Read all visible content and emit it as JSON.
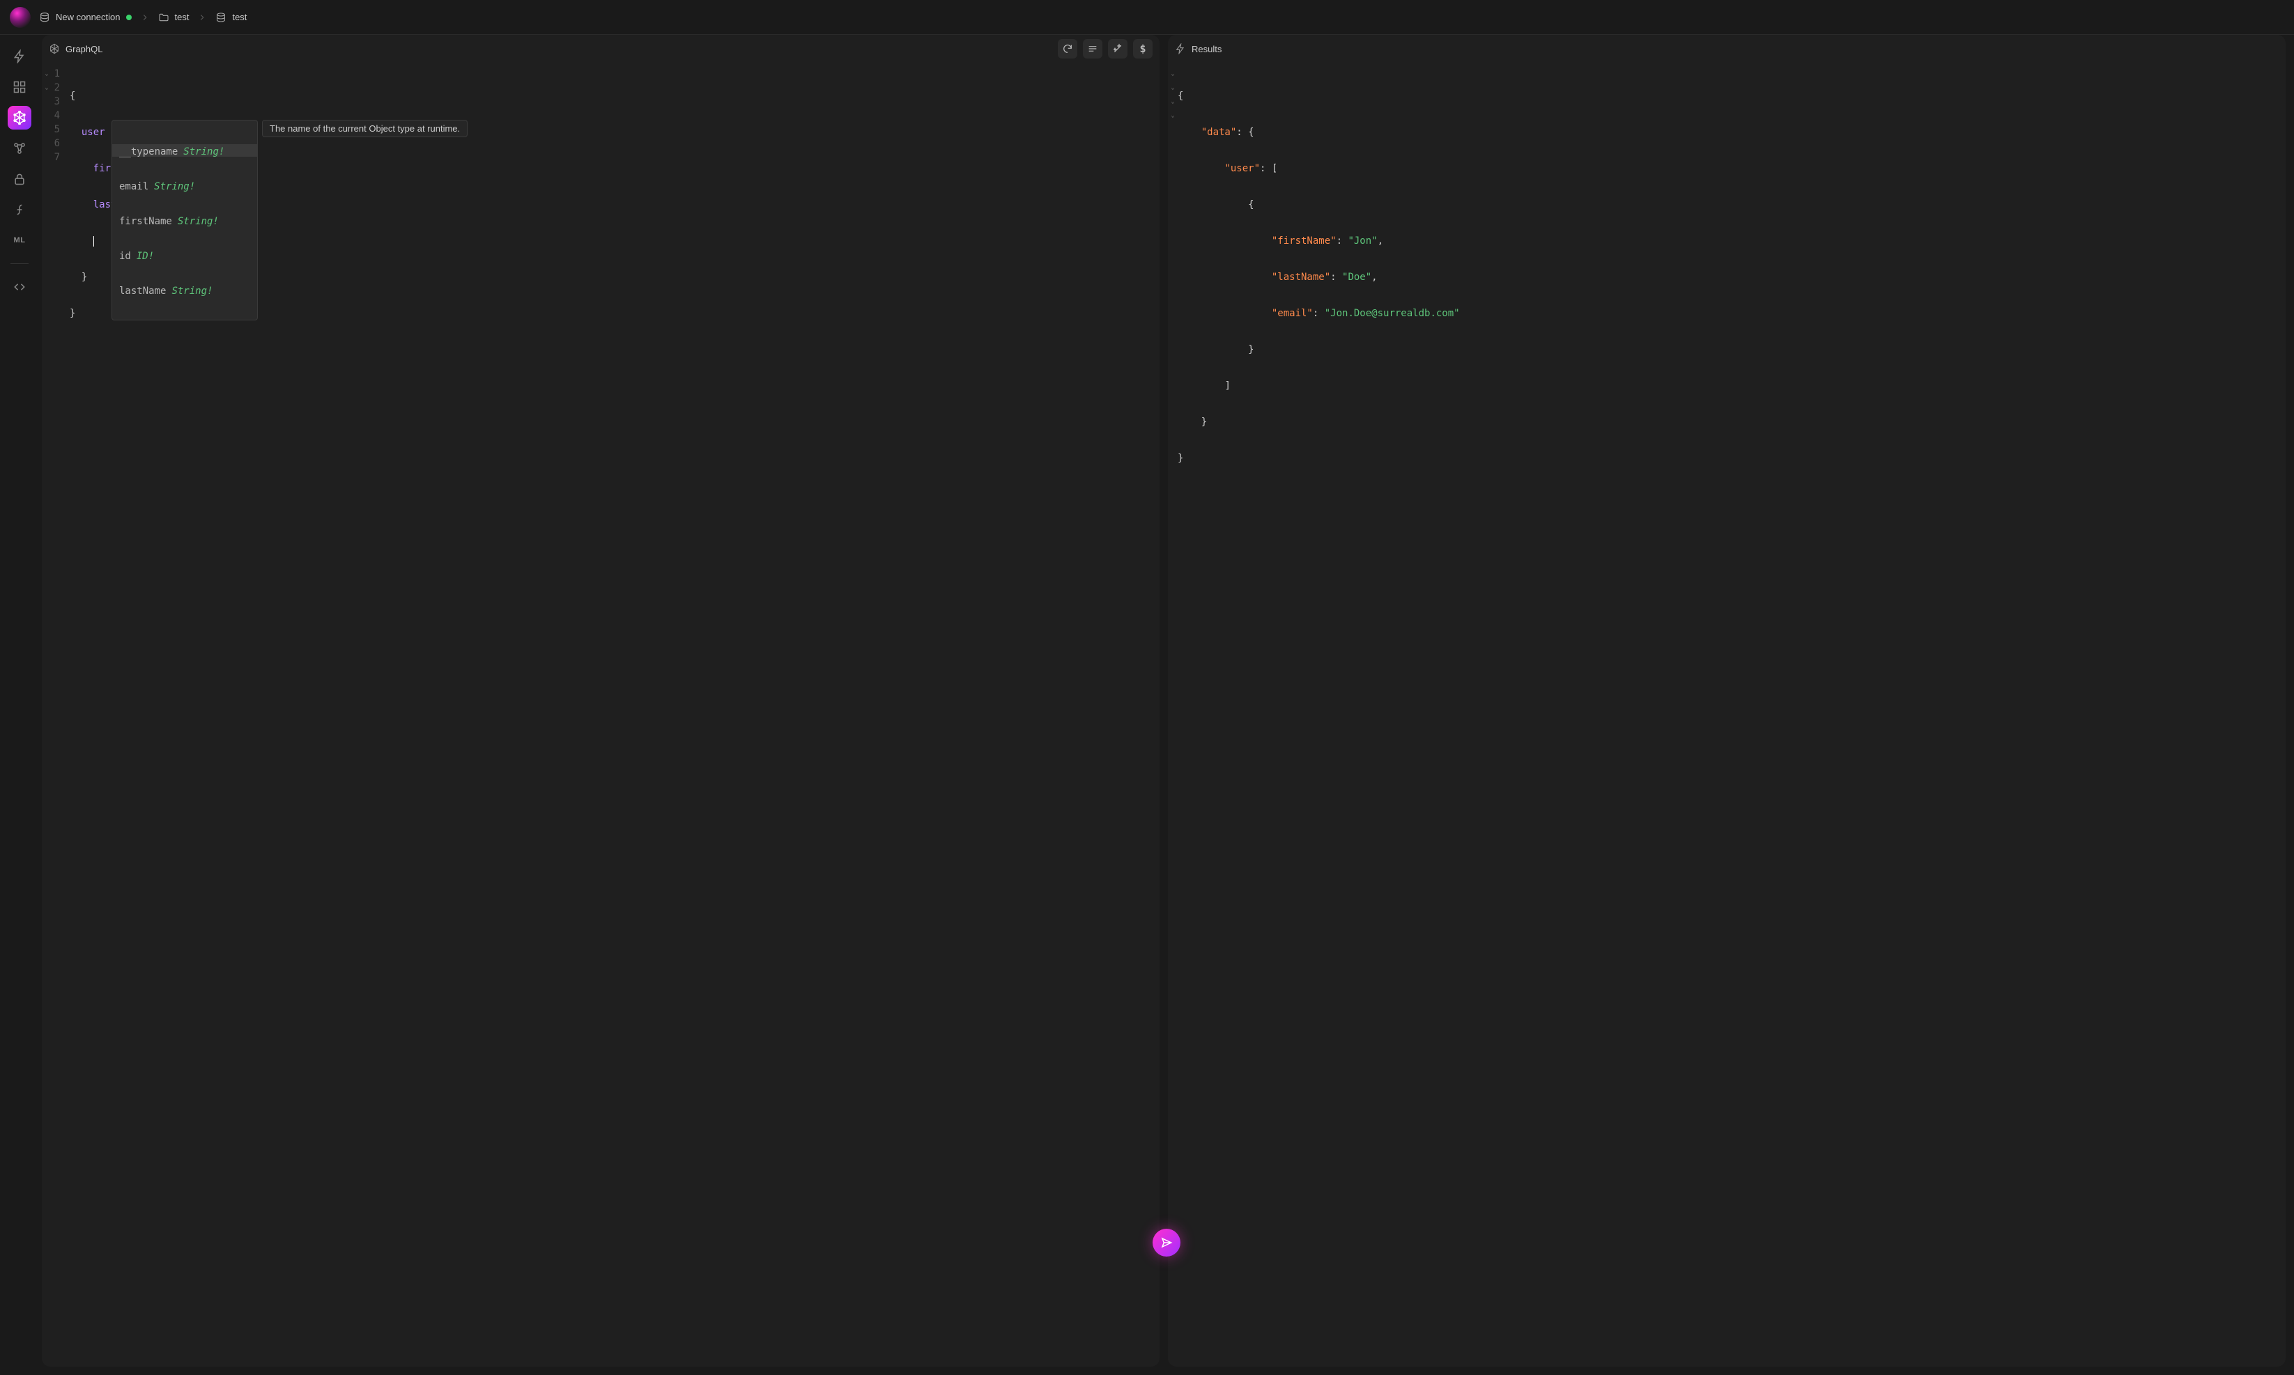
{
  "topbar": {
    "new_connection_label": "New connection",
    "ns_label": "test",
    "db_label": "test"
  },
  "rail": {
    "items": [
      {
        "name": "query",
        "icon": "lightning"
      },
      {
        "name": "explorer",
        "icon": "grid"
      },
      {
        "name": "graphql",
        "icon": "graphql",
        "active": true
      },
      {
        "name": "designer",
        "icon": "graph"
      },
      {
        "name": "auth",
        "icon": "lock"
      },
      {
        "name": "functions",
        "icon": "fx"
      },
      {
        "name": "models",
        "icon": "ml"
      },
      {
        "name": "api",
        "icon": "brackets"
      }
    ]
  },
  "editor": {
    "title": "GraphQL",
    "toolbar": {
      "refresh": "Refresh",
      "format": "Prettify",
      "wand": "Auto",
      "vars": "$"
    },
    "lines": [
      "1",
      "2",
      "3",
      "4",
      "5",
      "6",
      "7"
    ],
    "code": {
      "l1": "{",
      "l2_user": "user",
      "l2_brace": " {",
      "l3_field": "firstName",
      "l4_field": "lastName",
      "l6": "}",
      "l7": "}"
    },
    "autocomplete": {
      "items": [
        {
          "name": "__typename",
          "type": "String!",
          "selected": true
        },
        {
          "name": "email",
          "type": "String!"
        },
        {
          "name": "firstName",
          "type": "String!"
        },
        {
          "name": "id",
          "type": "ID!"
        },
        {
          "name": "lastName",
          "type": "String!"
        }
      ],
      "doc": "The name of the current Object type at runtime."
    }
  },
  "results": {
    "title": "Results",
    "json": {
      "data_key": "\"data\"",
      "user_key": "\"user\"",
      "firstName_key": "\"firstName\"",
      "firstName_val": "\"Jon\"",
      "lastName_key": "\"lastName\"",
      "lastName_val": "\"Doe\"",
      "email_key": "\"email\"",
      "email_val": "\"Jon.Doe@surrealdb.com\""
    }
  },
  "colors": {
    "accent": "#ff2fd0",
    "bg": "#1a1a1a",
    "panel": "#1f1f1f"
  }
}
